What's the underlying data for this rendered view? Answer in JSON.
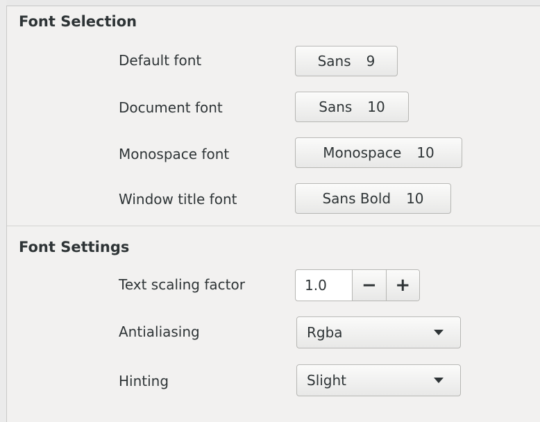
{
  "font_selection": {
    "title": "Font Selection",
    "rows": [
      {
        "label": "Default font",
        "font": "Sans",
        "size": "9"
      },
      {
        "label": "Document font",
        "font": "Sans",
        "size": "10"
      },
      {
        "label": "Monospace font",
        "font": "Monospace",
        "size": "10"
      },
      {
        "label": "Window title font",
        "font": "Sans Bold",
        "size": "10"
      }
    ]
  },
  "font_settings": {
    "title": "Font Settings",
    "text_scaling": {
      "label": "Text scaling factor",
      "value": "1.0",
      "decrement": "−",
      "increment": "+"
    },
    "antialiasing": {
      "label": "Antialiasing",
      "value": "Rgba"
    },
    "hinting": {
      "label": "Hinting",
      "value": "Slight"
    }
  }
}
